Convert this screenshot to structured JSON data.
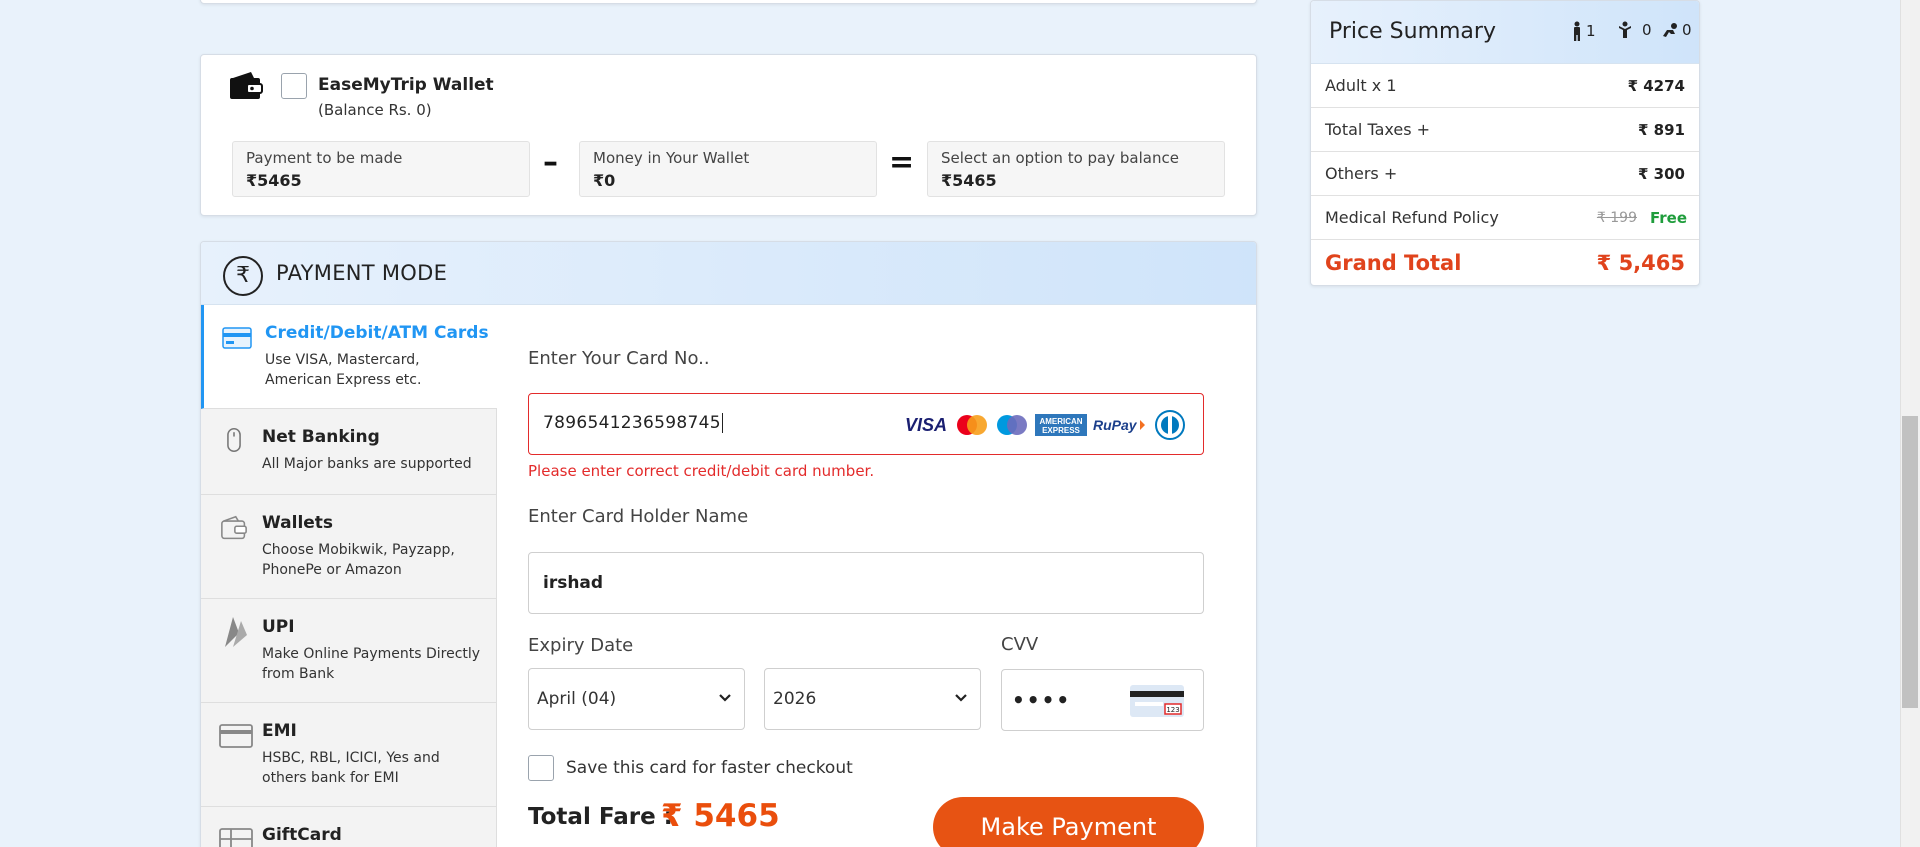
{
  "wallet": {
    "title": "EaseMyTrip Wallet",
    "balance": "(Balance Rs. 0)",
    "payment_label": "Payment to be made",
    "payment_value": "₹5465",
    "money_label": "Money in Your Wallet",
    "money_value": "₹0",
    "option_label": "Select an option to pay balance",
    "option_value": "₹5465",
    "minus": "–",
    "equals": "="
  },
  "payment_mode": {
    "title": "PAYMENT MODE",
    "rupee_symbol": "₹",
    "methods": [
      {
        "title": "Credit/Debit/ATM Cards",
        "desc": "Use VISA, Mastercard, American Express etc.",
        "icon": "credit-card-icon",
        "active": true
      },
      {
        "title": "Net Banking",
        "desc": "All Major banks are supported",
        "icon": "mouse-icon"
      },
      {
        "title": "Wallets",
        "desc": "Choose Mobikwik, Payzapp, PhonePe or Amazon",
        "icon": "wallet-icon"
      },
      {
        "title": "UPI",
        "desc": "Make Online Payments Directly from Bank",
        "icon": "upi-icon"
      },
      {
        "title": "EMI",
        "desc": "HSBC, RBL, ICICI, Yes and others bank for EMI",
        "icon": "emi-card-icon"
      },
      {
        "title": "GiftCard",
        "desc": "",
        "icon": "giftcard-icon"
      }
    ]
  },
  "card_form": {
    "card_label": "Enter Your Card No..",
    "card_value": "7896541236598745",
    "brands": [
      "VISA",
      "Mastercard",
      "Maestro",
      "AMERICAN EXPRESS",
      "RuPay",
      "Diners Club"
    ],
    "error": "Please enter correct credit/debit card number.",
    "holder_label": "Enter Card Holder Name",
    "holder_value": "irshad",
    "expiry_label": "Expiry Date",
    "month_value": "April (04)",
    "year_value": "2026",
    "cvv_label": "CVV",
    "cvv_value": "••••",
    "save_label": "Save this card for faster checkout",
    "fare_label": "Total Fare :",
    "fare_value": "₹ 5465",
    "button": "Make Payment"
  },
  "summary": {
    "title": "Price Summary",
    "adults": "1",
    "children": "0",
    "infants": "0",
    "rows": [
      {
        "label": "Adult x 1",
        "value": "₹ 4274"
      },
      {
        "label": "Total Taxes +",
        "value": "₹ 891"
      },
      {
        "label": "Others +",
        "value": "₹ 300"
      }
    ],
    "medical_label": "Medical Refund Policy",
    "medical_old": "₹ 199",
    "medical_new": "Free",
    "grand_label": "Grand Total",
    "grand_value": "₹ 5,465"
  },
  "colors": {
    "accent_blue": "#2196f3",
    "error_red": "#e32b2b",
    "brand_orange": "#e75313",
    "free_green": "#1f9d3c"
  }
}
